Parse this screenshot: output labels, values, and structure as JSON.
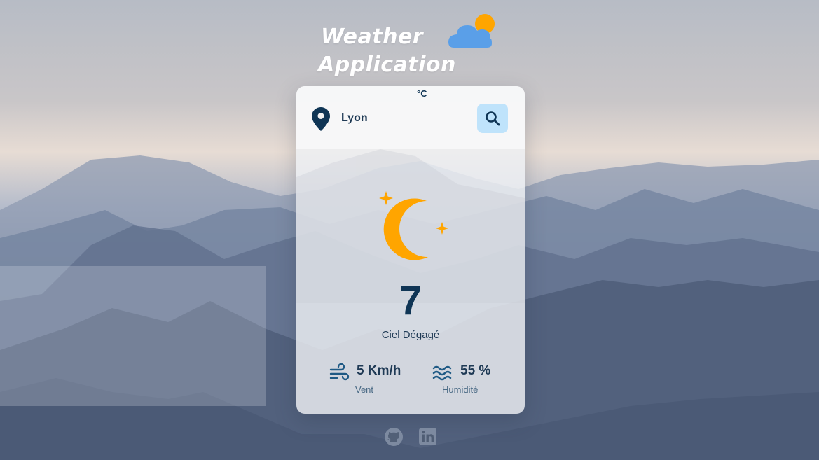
{
  "app": {
    "title_line1": "Weather",
    "title_line2": "Application"
  },
  "search": {
    "city": "Lyon",
    "button_icon": "search-icon",
    "location_icon": "map-pin-icon"
  },
  "weather": {
    "icon": "crescent-moon-stars-icon",
    "temperature": "7",
    "unit": "°C",
    "condition": "Ciel Dégagé",
    "wind_value": "5 Km/h",
    "wind_label": "Vent",
    "humidity_value": "55 %",
    "humidity_label": "Humidité"
  },
  "footer": {
    "links": [
      "github-icon",
      "linkedin-icon"
    ]
  },
  "colors": {
    "accent_orange": "#ffa500",
    "dark_navy": "#0f3555",
    "search_button_bg": "#bfe3fb",
    "cloud_blue": "#5a9fe8"
  }
}
